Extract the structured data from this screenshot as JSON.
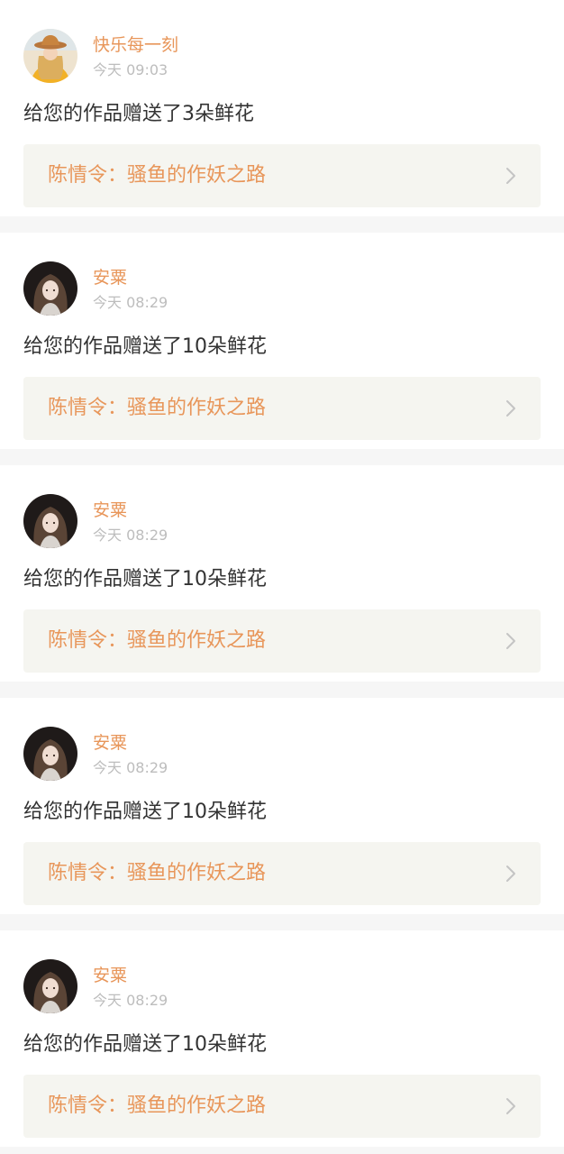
{
  "notifications": [
    {
      "user": "快乐每一刻",
      "avatar_icon": "avatar-blonde-hat",
      "time": "今天 09:03",
      "message": "给您的作品赠送了3朵鲜花",
      "work_title": "陈情令：骚鱼的作妖之路"
    },
    {
      "user": "安粟",
      "avatar_icon": "avatar-dark-hair",
      "time": "今天 08:29",
      "message": "给您的作品赠送了10朵鲜花",
      "work_title": "陈情令：骚鱼的作妖之路"
    },
    {
      "user": "安粟",
      "avatar_icon": "avatar-dark-hair",
      "time": "今天 08:29",
      "message": "给您的作品赠送了10朵鲜花",
      "work_title": "陈情令：骚鱼的作妖之路"
    },
    {
      "user": "安粟",
      "avatar_icon": "avatar-dark-hair",
      "time": "今天 08:29",
      "message": "给您的作品赠送了10朵鲜花",
      "work_title": "陈情令：骚鱼的作妖之路"
    },
    {
      "user": "安粟",
      "avatar_icon": "avatar-dark-hair",
      "time": "今天 08:29",
      "message": "给您的作品赠送了10朵鲜花",
      "work_title": "陈情令：骚鱼的作妖之路"
    }
  ],
  "colors": {
    "username": "#e8965a",
    "work_title": "#e8965a",
    "time": "#bdbdbd",
    "message": "#333333",
    "card_bg": "#ffffff",
    "link_bg": "#f5f5f0",
    "page_bg": "#f6f6f6"
  }
}
